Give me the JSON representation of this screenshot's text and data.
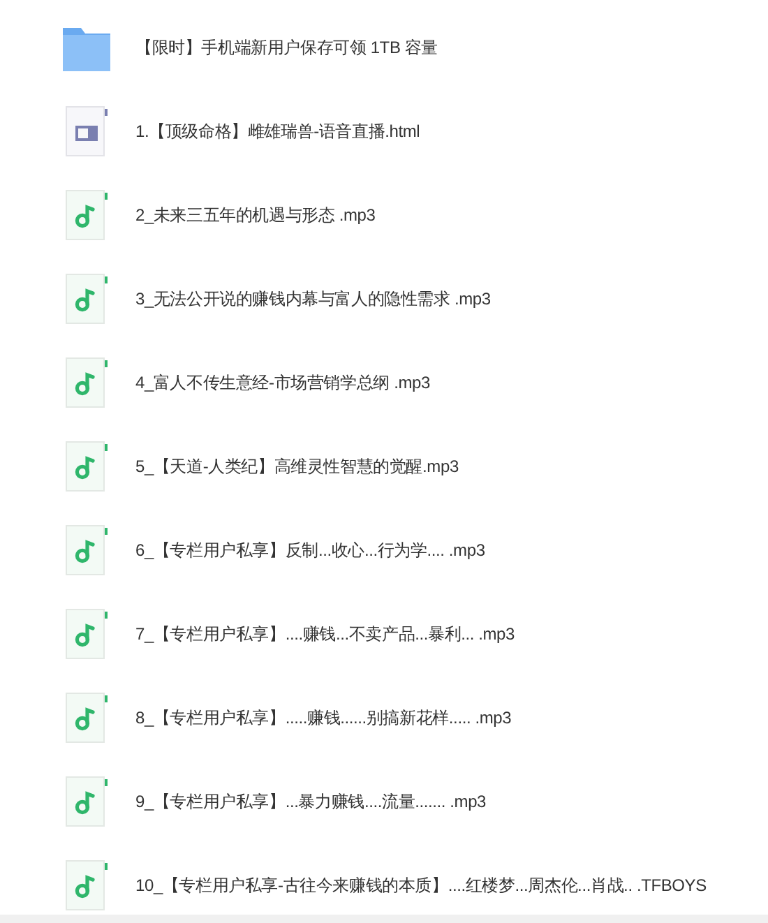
{
  "files": [
    {
      "kind": "folder",
      "name": "【限时】手机端新用户保存可领 1TB 容量"
    },
    {
      "kind": "html",
      "name": "1.【顶级命格】雌雄瑞兽-语音直播.html"
    },
    {
      "kind": "audio",
      "name": "2_未来三五年的机遇与形态 .mp3"
    },
    {
      "kind": "audio",
      "name": "3_无法公开说的赚钱内幕与富人的隐性需求 .mp3"
    },
    {
      "kind": "audio",
      "name": "4_富人不传生意经-市场营销学总纲 .mp3"
    },
    {
      "kind": "audio",
      "name": "5_【天道-人类纪】高维灵性智慧的觉醒.mp3"
    },
    {
      "kind": "audio",
      "name": "6_【专栏用户私享】反制...收心...行为学.... .mp3"
    },
    {
      "kind": "audio",
      "name": "7_【专栏用户私享】....赚钱...不卖产品...暴利... .mp3"
    },
    {
      "kind": "audio",
      "name": "8_【专栏用户私享】.....赚钱......别搞新花样..... .mp3"
    },
    {
      "kind": "audio",
      "name": "9_【专栏用户私享】...暴力赚钱....流量....... .mp3"
    },
    {
      "kind": "audio",
      "name": "10_【专栏用户私享-古往今来赚钱的本质】....红楼梦...周杰伦...肖战.. .TFBOYS"
    }
  ]
}
